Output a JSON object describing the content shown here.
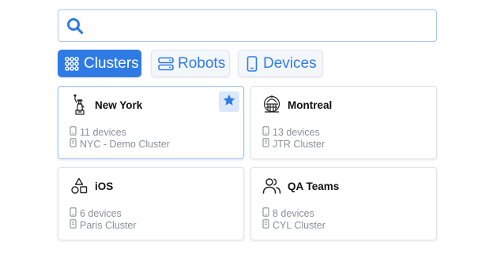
{
  "search": {
    "value": "",
    "placeholder": ""
  },
  "tabs": [
    {
      "label": "Clusters",
      "icon": "grid-icon",
      "active": true
    },
    {
      "label": "Robots",
      "icon": "server-icon",
      "active": false
    },
    {
      "label": "Devices",
      "icon": "phone-icon",
      "active": false
    }
  ],
  "cards": [
    {
      "title": "New York",
      "icon": "statue-of-liberty-icon",
      "devices": "11 devices",
      "cluster": "NYC - Demo Cluster",
      "favorite": true
    },
    {
      "title": "Montreal",
      "icon": "montreal-landmark-icon",
      "devices": "13 devices",
      "cluster": "JTR Cluster",
      "favorite": false
    },
    {
      "title": "iOS",
      "icon": "shapes-icon",
      "devices": "6 devices",
      "cluster": "Paris Cluster",
      "favorite": false
    },
    {
      "title": "QA Teams",
      "icon": "users-icon",
      "devices": "8 devices",
      "cluster": "CYL Cluster",
      "favorite": false
    }
  ],
  "colors": {
    "accent": "#2f7be5",
    "muted_text": "#8a8f97",
    "selected_border": "#9fc0ee"
  }
}
